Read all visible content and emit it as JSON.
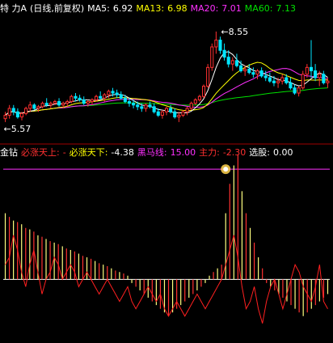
{
  "colors": {
    "up": "#ff3030",
    "down": "#00e5ff",
    "ma5": "#ffffff",
    "ma13": "#ffff00",
    "ma20": "#ff30ff",
    "ma60": "#00e000",
    "divider": "#a00000",
    "bar_pos_a": "#ffff80",
    "bar_pos_b": "#ff3030",
    "line_red": "#ff2020",
    "horse": "#ff30ff",
    "marker": "#ffd24d"
  },
  "main_header": {
    "symbol": "特 力A",
    "period": "(日线,前复权)",
    "ma5_label": "MA5:",
    "ma5_value": "6.92",
    "ma13_label": "MA13:",
    "ma13_value": "6.98",
    "ma20_label": "MA20:",
    "ma20_value": "7.01",
    "ma60_label": "MA60:",
    "ma60_value": "7.13",
    "arrow": "↓"
  },
  "sub_header": {
    "name": "金钻",
    "must_up_label": "必涨天上:",
    "must_up_value": "-",
    "must_down_label": "必涨天下:",
    "must_down_value": "-4.38",
    "horse_label": "黑马线:",
    "horse_value": "15.00",
    "main_force_label": "主力:",
    "main_force_value": "-2.30",
    "select_label": "选股:",
    "select_value": "0.00",
    "arrow": "↓"
  },
  "chart_data": [
    {
      "type": "candlestick",
      "panel": "main",
      "title": "特 力A (日线,前复权)",
      "price_labels": {
        "high": "8.55",
        "low": "5.57"
      },
      "ylim": [
        5.4,
        9.0
      ],
      "candles": [
        [
          6.0,
          6.2,
          5.9,
          6.1
        ],
        [
          6.1,
          6.4,
          6.0,
          6.3
        ],
        [
          6.3,
          6.4,
          6.1,
          6.2
        ],
        [
          6.2,
          6.3,
          6.0,
          6.05
        ],
        [
          6.05,
          6.2,
          5.95,
          6.15
        ],
        [
          6.15,
          6.35,
          6.1,
          6.3
        ],
        [
          6.3,
          6.5,
          6.2,
          6.4
        ],
        [
          6.4,
          6.45,
          6.25,
          6.3
        ],
        [
          6.3,
          6.4,
          6.2,
          6.35
        ],
        [
          6.35,
          6.5,
          6.3,
          6.45
        ],
        [
          6.45,
          6.6,
          6.35,
          6.4
        ],
        [
          6.4,
          6.5,
          6.3,
          6.45
        ],
        [
          6.45,
          6.55,
          6.4,
          6.5
        ],
        [
          6.5,
          6.6,
          6.35,
          6.4
        ],
        [
          6.4,
          6.5,
          6.3,
          6.45
        ],
        [
          6.45,
          6.55,
          6.35,
          6.5
        ],
        [
          6.5,
          6.7,
          6.45,
          6.65
        ],
        [
          6.65,
          6.75,
          6.5,
          6.6
        ],
        [
          6.6,
          6.7,
          6.5,
          6.55
        ],
        [
          6.55,
          6.65,
          6.4,
          6.45
        ],
        [
          6.45,
          6.55,
          6.35,
          6.5
        ],
        [
          6.5,
          6.6,
          6.4,
          6.55
        ],
        [
          6.55,
          6.7,
          6.5,
          6.65
        ],
        [
          6.65,
          6.8,
          6.55,
          6.6
        ],
        [
          6.6,
          6.75,
          6.5,
          6.7
        ],
        [
          6.7,
          6.85,
          6.6,
          6.8
        ],
        [
          6.8,
          6.9,
          6.65,
          6.75
        ],
        [
          6.75,
          6.85,
          6.6,
          6.7
        ],
        [
          6.7,
          6.8,
          6.55,
          6.6
        ],
        [
          6.6,
          6.7,
          6.45,
          6.5
        ],
        [
          6.5,
          6.6,
          6.35,
          6.45
        ],
        [
          6.45,
          6.55,
          6.3,
          6.4
        ],
        [
          6.4,
          6.5,
          6.25,
          6.35
        ],
        [
          6.35,
          6.45,
          6.2,
          6.3
        ],
        [
          6.3,
          6.45,
          6.2,
          6.4
        ],
        [
          6.4,
          6.5,
          6.3,
          6.35
        ],
        [
          6.35,
          6.45,
          6.15,
          6.2
        ],
        [
          6.2,
          6.3,
          6.05,
          6.1
        ],
        [
          6.1,
          6.25,
          6.0,
          6.2
        ],
        [
          6.2,
          6.35,
          6.1,
          6.3
        ],
        [
          6.3,
          6.4,
          6.15,
          6.2
        ],
        [
          6.2,
          6.3,
          6.0,
          6.05
        ],
        [
          6.05,
          6.2,
          5.9,
          6.1
        ],
        [
          6.1,
          6.25,
          6.05,
          6.2
        ],
        [
          6.2,
          6.35,
          6.1,
          6.3
        ],
        [
          6.3,
          6.5,
          6.25,
          6.45
        ],
        [
          6.45,
          6.6,
          6.4,
          6.55
        ],
        [
          6.55,
          6.7,
          6.5,
          6.65
        ],
        [
          6.65,
          7.0,
          6.6,
          6.95
        ],
        [
          6.95,
          7.6,
          6.9,
          7.5
        ],
        [
          7.5,
          8.2,
          7.4,
          8.1
        ],
        [
          8.1,
          8.55,
          7.9,
          8.3
        ],
        [
          8.3,
          8.4,
          7.9,
          8.0
        ],
        [
          8.0,
          8.2,
          7.7,
          7.8
        ],
        [
          7.8,
          8.0,
          7.5,
          7.6
        ],
        [
          7.6,
          7.8,
          7.4,
          7.7
        ],
        [
          7.7,
          7.9,
          7.5,
          7.55
        ],
        [
          7.55,
          7.7,
          7.35,
          7.4
        ],
        [
          7.4,
          7.55,
          7.25,
          7.45
        ],
        [
          7.45,
          7.6,
          7.3,
          7.35
        ],
        [
          7.35,
          7.5,
          7.2,
          7.3
        ],
        [
          7.3,
          7.45,
          7.15,
          7.4
        ],
        [
          7.4,
          7.5,
          7.2,
          7.25
        ],
        [
          7.25,
          7.4,
          7.1,
          7.2
        ],
        [
          7.2,
          7.35,
          7.05,
          7.1
        ],
        [
          7.1,
          7.25,
          6.95,
          7.05
        ],
        [
          7.05,
          7.2,
          6.9,
          7.1
        ],
        [
          7.1,
          7.3,
          7.0,
          7.2
        ],
        [
          7.2,
          7.3,
          7.0,
          7.05
        ],
        [
          7.05,
          7.2,
          6.85,
          6.9
        ],
        [
          6.9,
          7.0,
          6.7,
          6.75
        ],
        [
          6.75,
          6.95,
          6.65,
          6.9
        ],
        [
          6.9,
          7.4,
          6.85,
          7.3
        ],
        [
          7.3,
          7.6,
          7.2,
          7.5
        ],
        [
          7.5,
          8.3,
          7.2,
          7.4
        ],
        [
          7.4,
          7.6,
          7.1,
          7.2
        ],
        [
          7.2,
          7.4,
          6.95,
          7.3
        ],
        [
          7.3,
          7.4,
          7.0,
          7.05
        ],
        [
          7.05,
          7.2,
          6.9,
          7.1
        ]
      ]
    },
    {
      "type": "bar",
      "panel": "sub",
      "title": "金钻",
      "ylim": [
        -8,
        16
      ],
      "bars": [
        9,
        8.5,
        8,
        7.8,
        7.5,
        7,
        6.8,
        6.5,
        6,
        5.8,
        5.5,
        5.2,
        5,
        4.8,
        4.5,
        4.2,
        4,
        3.8,
        3.5,
        3.2,
        3,
        2.8,
        2.5,
        2.2,
        2,
        1.8,
        1.5,
        1.2,
        1,
        0.8,
        0.5,
        -0.5,
        -1,
        -1.5,
        -2,
        -2.5,
        -3,
        -3.5,
        -4,
        -4.5,
        -5,
        -4.5,
        -4,
        -3.5,
        -3,
        -2.5,
        -2,
        -1.5,
        -1,
        -0.5,
        0.5,
        1,
        1.5,
        2,
        9,
        13,
        15.5,
        17,
        12,
        9,
        7,
        5,
        3,
        1.5,
        -0.5,
        -1,
        -1.5,
        -2,
        -2.5,
        -3,
        -3.5,
        -4,
        -4.5,
        -5,
        -4.5,
        -4,
        -3.5,
        -3,
        -2.5,
        -2
      ],
      "line": [
        2,
        3,
        6,
        4,
        1,
        -1,
        2,
        4,
        1,
        -2,
        0,
        1,
        3,
        2,
        0,
        1,
        2,
        1,
        -1,
        0,
        1,
        0,
        -1,
        -2,
        -1,
        0,
        -1,
        -2,
        -3,
        -2,
        -1,
        -3,
        -4,
        -3,
        -2,
        -1,
        -2,
        -3,
        -2,
        -4,
        -5,
        -4,
        -3,
        -4,
        -5,
        -4,
        -3,
        -2,
        -3,
        -4,
        -3,
        -2,
        -1,
        0,
        2,
        4,
        6,
        3,
        -1,
        -4,
        -3,
        -1,
        -4,
        -6,
        -3,
        -1,
        0,
        -2,
        -4,
        -2,
        0,
        2,
        1,
        -1,
        -2,
        -3,
        -1,
        2,
        -3,
        -4
      ],
      "horse_line": 15.0,
      "marker_index": 54
    }
  ]
}
